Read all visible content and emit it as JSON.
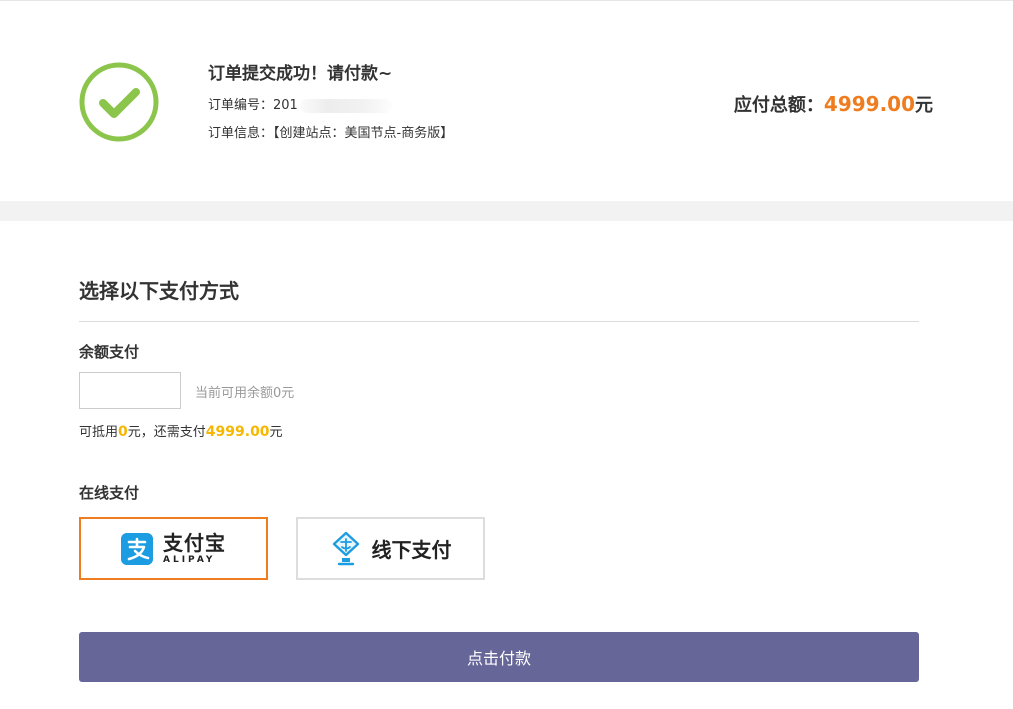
{
  "order": {
    "title": "订单提交成功！请付款~",
    "number_label": "订单编号：",
    "number_value": "201",
    "info_label": "订单信息：",
    "info_value": "【创建站点：美国节点-商务版】",
    "total_label": "应付总额：",
    "total_amount": "4999.00",
    "total_unit": "元"
  },
  "payment": {
    "section_title": "选择以下支付方式",
    "balance": {
      "label": "余额支付",
      "input_value": "",
      "hint": "当前可用余额0元",
      "calc_prefix": "可抵用",
      "calc_deductible": "0",
      "calc_middle": "元，还需支付",
      "calc_remaining": "4999.00",
      "calc_suffix": "元"
    },
    "online": {
      "label": "在线支付",
      "options": [
        {
          "name": "支付宝",
          "sub": "ALIPAY",
          "selected": true,
          "icon": "alipay-icon"
        },
        {
          "name": "线下支付",
          "selected": false,
          "icon": "offline-payment-icon"
        }
      ]
    },
    "submit_label": "点击付款"
  },
  "colors": {
    "accent_orange": "#ef7d1f",
    "highlight_yellow": "#f5b700",
    "button_purple": "#676698",
    "success_green": "#8cc54b",
    "alipay_blue": "#1c9de1"
  }
}
